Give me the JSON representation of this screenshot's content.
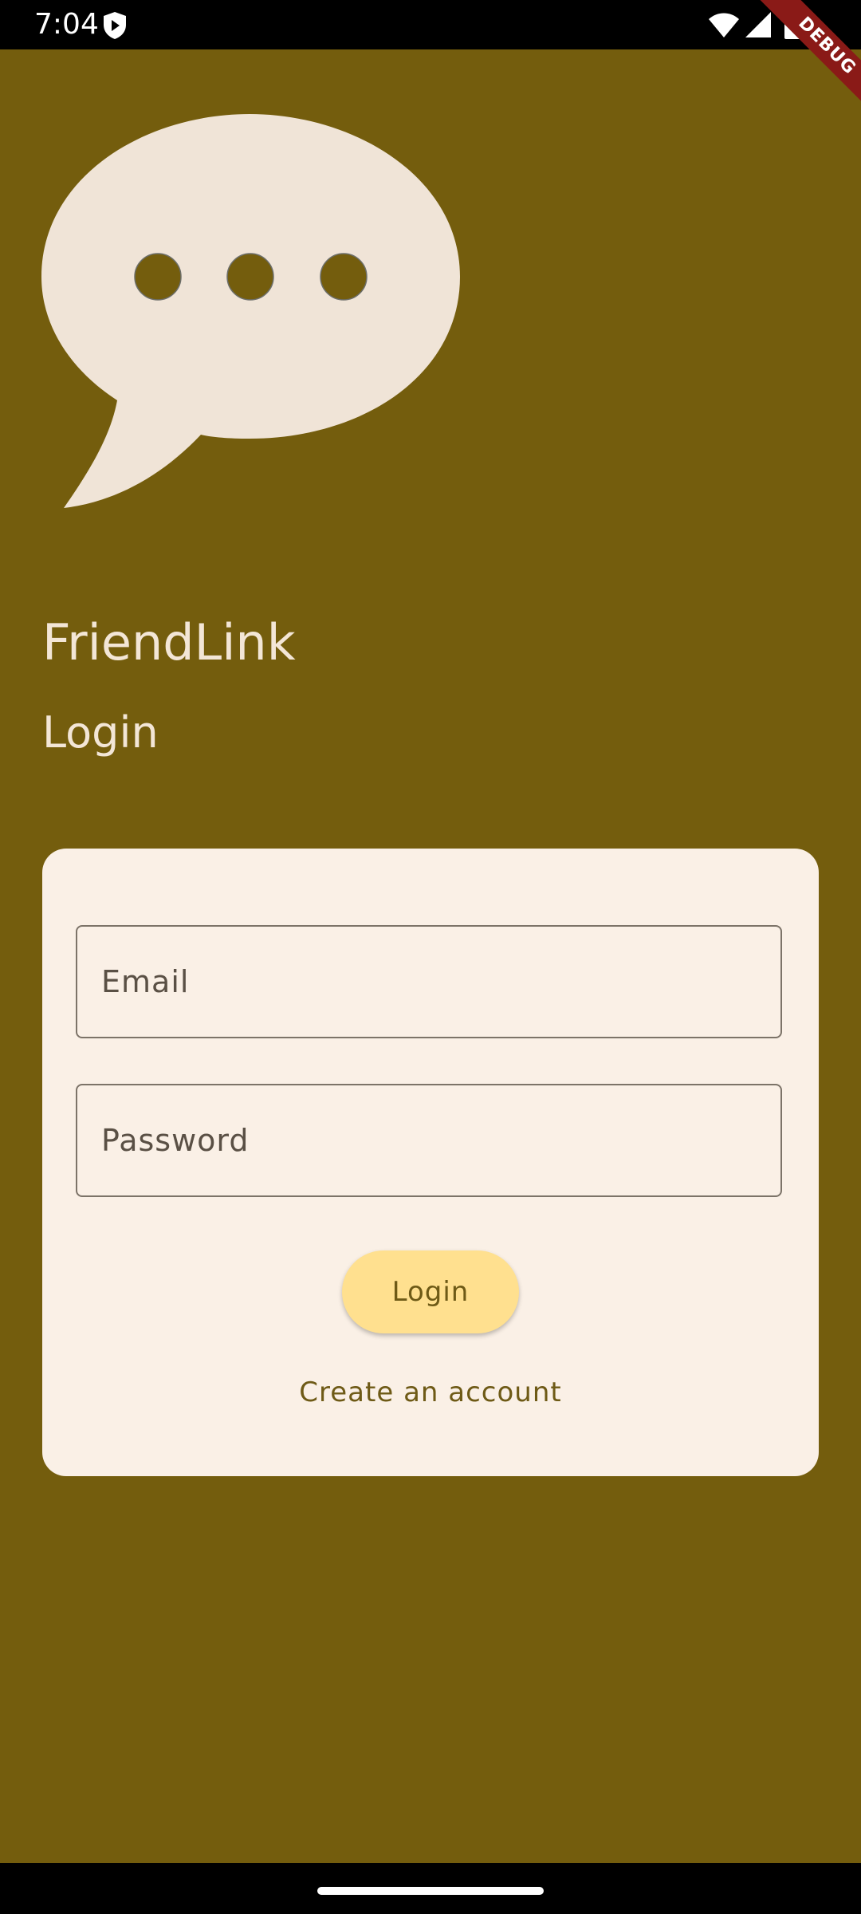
{
  "status_bar": {
    "time": "7:04"
  },
  "debug_banner": {
    "label": "DEBUG"
  },
  "app": {
    "title": "FriendLink",
    "subtitle": "Login"
  },
  "form": {
    "email_placeholder": "Email",
    "email_value": "",
    "password_placeholder": "Password",
    "password_value": "",
    "login_label": "Login",
    "create_account_label": "Create an account"
  },
  "colors": {
    "background": "#745d0d",
    "card": "#faf0e6",
    "button": "#ffe08f",
    "accent_text": "#6e5a16",
    "title_text": "#f3e6d6",
    "debug_ribbon": "#8a1a17"
  },
  "icons": {
    "logo": "chat-bubble-icon",
    "shield": "shield-icon",
    "wifi": "wifi-icon",
    "signal": "signal-icon",
    "battery": "battery-icon"
  }
}
